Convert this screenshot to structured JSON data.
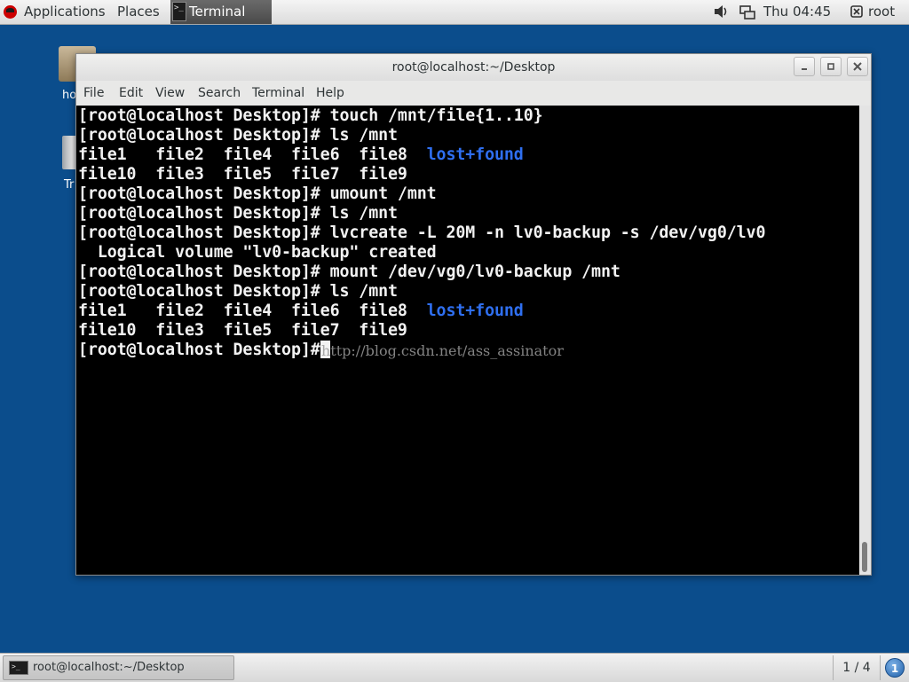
{
  "top_panel": {
    "applications": "Applications",
    "places": "Places",
    "active_task": "Terminal",
    "clock": "Thu 04:45",
    "user": "root"
  },
  "desktop": {
    "home_label": "ho",
    "trash_label": "Tr"
  },
  "window": {
    "title": "root@localhost:~/Desktop",
    "menu": [
      "File",
      "Edit",
      "View",
      "Search",
      "Terminal",
      "Help"
    ]
  },
  "terminal": {
    "lines": [
      {
        "text": "[root@localhost Desktop]# touch /mnt/file{1..10}"
      },
      {
        "text": "[root@localhost Desktop]# ls /mnt"
      },
      {
        "text": "file1   file2  file4  file6  file8  ",
        "highlight": "lost+found"
      },
      {
        "text": "file10  file3  file5  file7  file9"
      },
      {
        "text": "[root@localhost Desktop]# umount /mnt"
      },
      {
        "text": "[root@localhost Desktop]# ls /mnt"
      },
      {
        "text": "[root@localhost Desktop]# lvcreate -L 20M -n lv0-backup -s /dev/vg0/lv0"
      },
      {
        "text": "  Logical volume \"lv0-backup\" created"
      },
      {
        "text": "[root@localhost Desktop]# mount /dev/vg0/lv0-backup /mnt"
      },
      {
        "text": "[root@localhost Desktop]# ls /mnt"
      },
      {
        "text": "file1   file2  file4  file6  file8  ",
        "highlight": "lost+found"
      },
      {
        "text": "file10  file3  file5  file7  file9"
      }
    ],
    "prompt": "[root@localhost Desktop]#",
    "watermark": "http://blog.csdn.net/ass_assinator"
  },
  "bottom_panel": {
    "task_label": "root@localhost:~/Desktop",
    "workspace": "1 / 4",
    "notifications": "1"
  },
  "colors": {
    "desktop_bg": "#0b4d8c",
    "directory_text": "#2f6ff0",
    "terminal_bg": "#000000"
  }
}
